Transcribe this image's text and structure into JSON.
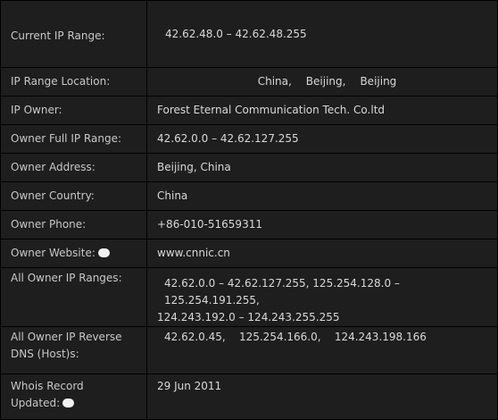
{
  "current_range": {
    "label": "Current IP Range:",
    "value": "42.62.48.0 – 42.62.48.255"
  },
  "location": {
    "label": "IP Range Location:",
    "parts": [
      "China,",
      "Beijing,",
      "Beijing"
    ]
  },
  "owner": {
    "label": "IP Owner:",
    "value": "Forest Eternal Communication Tech. Co.ltd"
  },
  "owner_full_range": {
    "label": "Owner Full IP Range:",
    "value": "42.62.0.0 – 42.62.127.255"
  },
  "owner_address": {
    "label": "Owner Address:",
    "value": "Beijing, China"
  },
  "owner_country": {
    "label": "Owner Country:",
    "value": "China"
  },
  "owner_phone": {
    "label": "Owner Phone:",
    "value": "+86-010-51659311"
  },
  "owner_website": {
    "label": "Owner Website:",
    "value": "www.cnnic.cn",
    "icon": "info-icon"
  },
  "all_ranges": {
    "label": "All Owner IP Ranges:",
    "line1": "42.62.0.0 – 42.62.127.255,   125.254.128.0 – 125.254.191.255,",
    "line2": "124.243.192.0 – 124.243.255.255"
  },
  "reverse_dns": {
    "label_line1": "All Owner IP Reverse",
    "label_line2": "DNS (Host)s:",
    "value": "42.62.0.45,    125.254.166.0,    124.243.198.166"
  },
  "whois": {
    "label_line1": "Whois Record",
    "label_line2": "Updated:",
    "value": "29 Jun 2011",
    "icon": "info-icon"
  }
}
